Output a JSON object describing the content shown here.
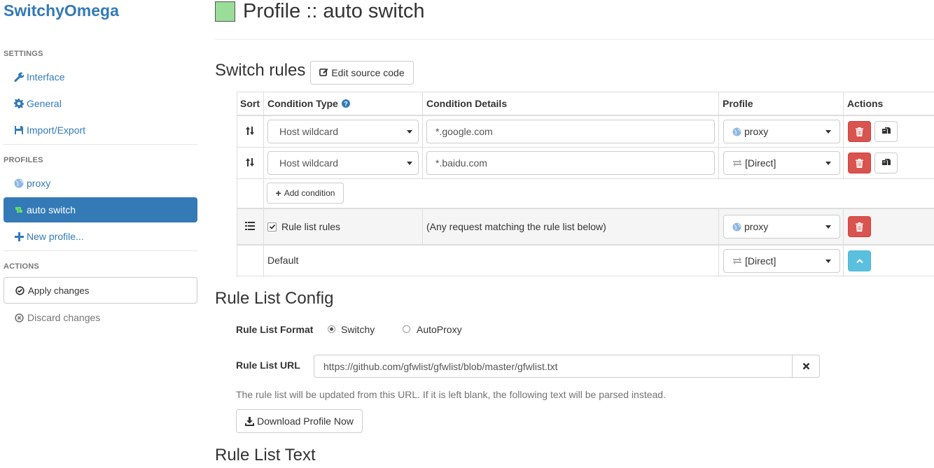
{
  "sidebar": {
    "brand": "SwitchyOmega",
    "settings_header": "SETTINGS",
    "settings_items": [
      {
        "label": "Interface",
        "icon": "wrench-icon"
      },
      {
        "label": "General",
        "icon": "gear-icon"
      },
      {
        "label": "Import/Export",
        "icon": "floppy-disk-icon"
      }
    ],
    "profiles_header": "PROFILES",
    "profile_items": [
      {
        "label": "proxy",
        "icon": "globe-icon",
        "active": false
      },
      {
        "label": "auto switch",
        "icon": "retweet-icon",
        "active": true
      },
      {
        "label": "New profile...",
        "icon": "plus-icon",
        "active": false
      }
    ],
    "actions_header": "ACTIONS",
    "apply_label": "Apply changes",
    "discard_label": "Discard changes"
  },
  "page": {
    "title": "Profile :: auto switch",
    "profile_color": "#99dd99"
  },
  "switch_rules": {
    "heading": "Switch rules",
    "edit_source_label": "Edit source code",
    "columns": [
      "Sort",
      "Condition Type",
      "Condition Details",
      "Profile",
      "Actions"
    ],
    "rules": [
      {
        "condition_type": "Host wildcard",
        "condition_details": "*.google.com",
        "profile": "proxy",
        "profile_icon": "globe-icon"
      },
      {
        "condition_type": "Host wildcard",
        "condition_details": "*.baidu.com",
        "profile": "[Direct]",
        "profile_icon": "exchange-icon"
      }
    ],
    "add_condition_label": "Add condition",
    "rule_list_row": {
      "label": "Rule list rules",
      "checked": true,
      "details": "(Any request matching the rule list below)",
      "profile": "proxy"
    },
    "default_row": {
      "label": "Default",
      "profile": "[Direct]"
    }
  },
  "rule_list_config": {
    "heading": "Rule List Config",
    "format_label": "Rule List Format",
    "format_options": [
      "Switchy",
      "AutoProxy"
    ],
    "format_selected": "Switchy",
    "url_label": "Rule List URL",
    "url_value": "https://github.com/gfwlist/gfwlist/blob/master/gfwlist.txt",
    "help_text": "The rule list will be updated from this URL. If it is left blank, the following text will be parsed instead.",
    "download_label": "Download Profile Now"
  },
  "rule_list_text": {
    "heading": "Rule List Text"
  },
  "colors": {
    "primary": "#337ab7",
    "danger": "#d9534f",
    "info": "#5bc0de"
  }
}
